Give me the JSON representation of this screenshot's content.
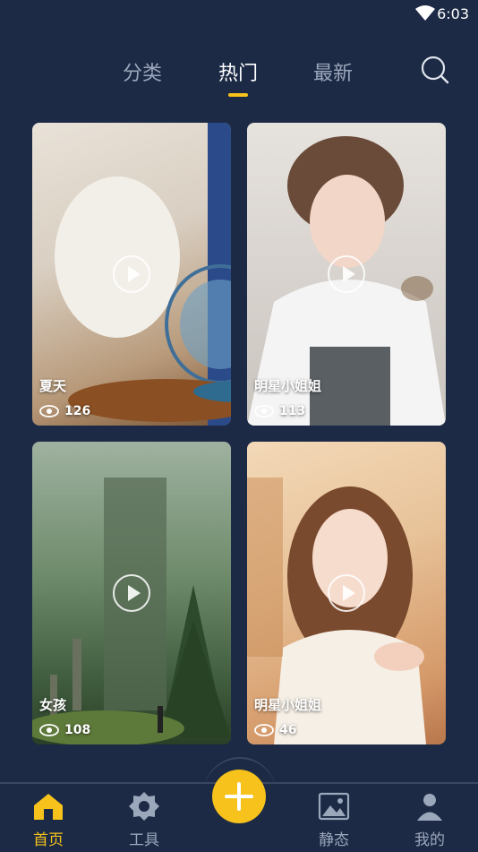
{
  "status": {
    "time": "6:03"
  },
  "tabs": [
    {
      "label": "分类"
    },
    {
      "label": "热门"
    },
    {
      "label": "最新"
    }
  ],
  "cards": [
    {
      "title": "夏天",
      "views": "126"
    },
    {
      "title": "明星小姐姐",
      "views": "113"
    },
    {
      "title": "女孩",
      "views": "108"
    },
    {
      "title": "明星小姐姐",
      "views": "46"
    }
  ],
  "nav": [
    {
      "label": "首页"
    },
    {
      "label": "工具"
    },
    {
      "label": "静态"
    },
    {
      "label": "我的"
    }
  ],
  "colors": {
    "accent": "#f6c21b",
    "background": "#1c2a45"
  }
}
